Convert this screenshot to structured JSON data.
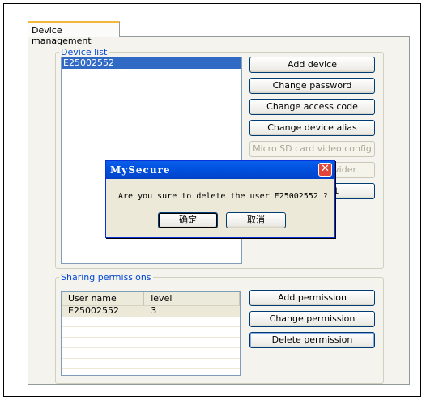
{
  "tab": {
    "label": "Device management"
  },
  "device_list": {
    "legend": "Device list",
    "items": [
      "E25002552"
    ]
  },
  "device_buttons": {
    "add_device": "Add device",
    "change_password": "Change password",
    "change_access_code": "Change access code",
    "change_alias": "Change device alias",
    "sd_config": "Micro SD card video config",
    "provider": "ovider",
    "hidden_button": "t"
  },
  "sharing": {
    "legend": "Sharing permissions",
    "columns": [
      "User name",
      "level"
    ],
    "rows": [
      {
        "user": "E25002552",
        "level": "3"
      }
    ],
    "add_permission": "Add permission",
    "change_permission": "Change permission",
    "delete_permission": "Delete permission"
  },
  "dialog": {
    "title": "MySecure",
    "message": "Are you sure to delete the user E25002552 ?",
    "ok": "确定",
    "cancel": "取消",
    "close_icon": "close-icon"
  }
}
